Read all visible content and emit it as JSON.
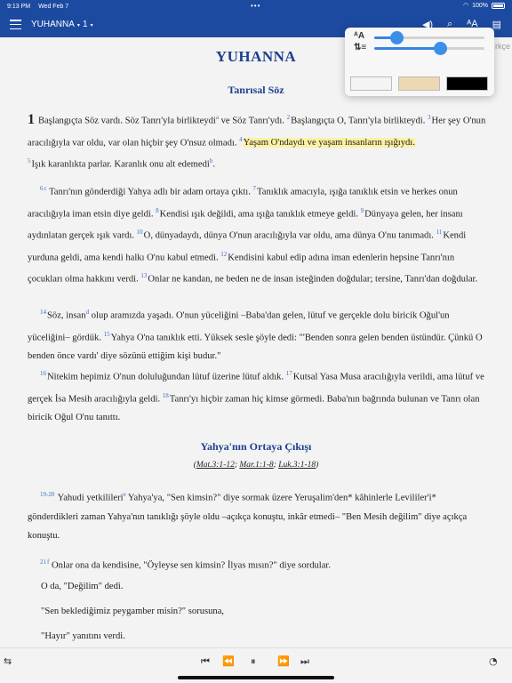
{
  "status": {
    "time": "9:13 PM",
    "date": "Wed Feb 7",
    "dots": "•••",
    "battery": "100%"
  },
  "nav": {
    "book": "YUHANNA",
    "chapter": "1",
    "caret": "▾"
  },
  "icons": {
    "menu": "hamburger-icon",
    "audio": "speaker-icon",
    "search": "search-icon",
    "font": "font-size-icon",
    "panel": "book-panel-icon"
  },
  "popup": {
    "font_size_level": 0.2,
    "line_spacing_level": 0.6,
    "themes_colors": [
      "#f4f4f4",
      "#ecd9b4",
      "#000000"
    ],
    "icon1": "ᴬA",
    "icon2": "⇅≡",
    "side_label": "rkçe"
  },
  "title": "YUHANNA",
  "section1": "Tanrısal Söz",
  "p1": {
    "chap": "1",
    "t1": "Başlangıçta Söz vardı. Söz Tanrı'yla birlikteydi",
    "f1": "a",
    "t2": " ve Söz Tanrı'ydı. ",
    "v2": "2",
    "t3": "Başlangıçta O, Tanrı'yla birlikteydi. ",
    "v3": "3",
    "t4": "Her şey O'nun aracılığıyla var oldu, var olan hiçbir şey O'nsuz olmadı. ",
    "v4": "4",
    "t5": "Yaşam O'ndaydı ve yaşam insanların ışığıydı.",
    "v5": "5",
    "t6": "Işık karanlıkta parlar. Karanlık onu alt edemedi",
    "f2": "b",
    "t7": "."
  },
  "p2": {
    "v6": "6",
    "f": "c",
    "t1": " Tanrı'nın gönderdiği Yahya adlı bir adam ortaya çıktı. ",
    "v7": "7",
    "t2": "Tanıklık amacıyla, ışığa tanıklık etsin ve herkes onun aracılığıyla iman etsin diye geldi. ",
    "v8": "8",
    "t3": "Kendisi ışık değildi, ama ışığa tanıklık etmeye geldi. ",
    "v9": "9",
    "t4": "Dünyaya gelen, her insanı aydınlatan gerçek ışık vardı. ",
    "v10": "10",
    "t5": "O, dünyadaydı, dünya O'nun aracılığıyla var oldu, ama dünya O'nu tanımadı. ",
    "v11": "11",
    "t6": "Kendi yurduna geldi, ama kendi halkı O'nu kabul etmedi. ",
    "v12": "12",
    "t7": "Kendisini kabul edip adına iman edenlerin hepsine Tanrı'nın çocukları olma hakkını verdi. ",
    "v13": "13",
    "t8": "Onlar ne kandan, ne beden ne de insan isteğinden doğdular; tersine, Tanrı'dan doğdular."
  },
  "p3": {
    "v14": "14",
    "t1": "Söz, insan",
    "f": "d",
    "t2": " olup aramızda yaşadı. O'nun yüceliğini –Baba'dan gelen, lütuf ve gerçekle dolu biricik Oğul'un yüceliğini– gördük. ",
    "v15": "15",
    "t3": "Yahya O'na tanıklık etti. Yüksek sesle şöyle dedi: \"'Benden sonra gelen benden üstündür. Çünkü O benden önce vardı' diye sözünü ettiğim kişi budur.\""
  },
  "p4": {
    "v16": "16",
    "t1": "Nitekim hepimiz O'nun doluluğundan lütuf üzerine lütuf aldık. ",
    "v17": "17",
    "t2": "Kutsal Yasa Musa aracılığıyla verildi, ama lütuf ve gerçek İsa Mesih aracılığıyla geldi. ",
    "v18": "18",
    "t3": "Tanrı'yı hiçbir zaman hiç kimse görmedi. Baba'nın bağrında bulunan ve Tanrı olan biricik Oğul O'nu tanıttı."
  },
  "section2": "Yahya'nın Ortaya Çıkışı",
  "xref": {
    "open": "(",
    "a": "Mat.3:1-12",
    "s1": "; ",
    "b": "Mar.1:1-8",
    "s2": "; ",
    "c": "Luk.3:1-18",
    "close": ")"
  },
  "p5": {
    "v": "19-20",
    "t1": " Yahudi yetkilileri",
    "f": "e",
    "t2": " Yahya'ya, \"Sen kimsin?\" diye sormak üzere Yeruşalim'den* kâhinlerle Levililer'i* gönderdikleri zaman Yahya'nın tanıklığı şöyle oldu –açıkça konuştu, inkâr etmedi– \"Ben Mesih değilim\" diye açıkça konuştu."
  },
  "p6": {
    "v": "21",
    "f": "f",
    "t": " Onlar ona da kendisine, \"Öyleyse sen kimsin? İlyas mısın?\" diye sordular."
  },
  "l1": "O da, \"Değilim\" dedi.",
  "l2": "\"Sen beklediğimiz peygamber misin?\" sorusuna,",
  "l3": "\"Hayır\" yanıtını verdi.",
  "bottom": {
    "list": "⇆",
    "prev": "⏮",
    "rew": "⏪",
    "pause": "⏸",
    "ff": "⏩",
    "next": "⏭",
    "speed": "◔"
  }
}
